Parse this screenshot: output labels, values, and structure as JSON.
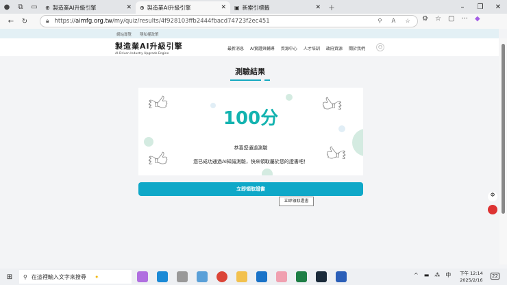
{
  "browser": {
    "tabs": [
      {
        "label": "製造業AI升級引擎",
        "active": false
      },
      {
        "label": "製造業AI升級引擎",
        "active": true
      },
      {
        "label": "新索引標籤",
        "active": false
      }
    ],
    "url_prefix": "https://",
    "url_domain": "aimfg.org.tw",
    "url_path": "/my/quiz/results/4f928103ffb2444fbacd74723f2ec451"
  },
  "site": {
    "top_links": [
      "網站導覽",
      "隱私權政策"
    ],
    "logo_title": "製造業AI升級引擎",
    "logo_subtitle": "AI-Driven Industry Upgrade Engine",
    "nav": [
      "最新消息",
      "AI實證與輔導",
      "資源中心",
      "人才培訓",
      "政府資源",
      "關於我們"
    ]
  },
  "result": {
    "title": "測驗結果",
    "score": "100分",
    "message1": "恭喜您通過測驗",
    "message2": "您已成功通過AI知識測驗，快來領取屬於您的證書吧！",
    "button": "立即領取證書",
    "tooltip": "立即領取證書"
  },
  "taskbar": {
    "search_placeholder": "在這裡輸入文字來搜尋",
    "ime": "中",
    "time": "下午 12:14",
    "date": "2025/2/16",
    "notifications": "22"
  }
}
